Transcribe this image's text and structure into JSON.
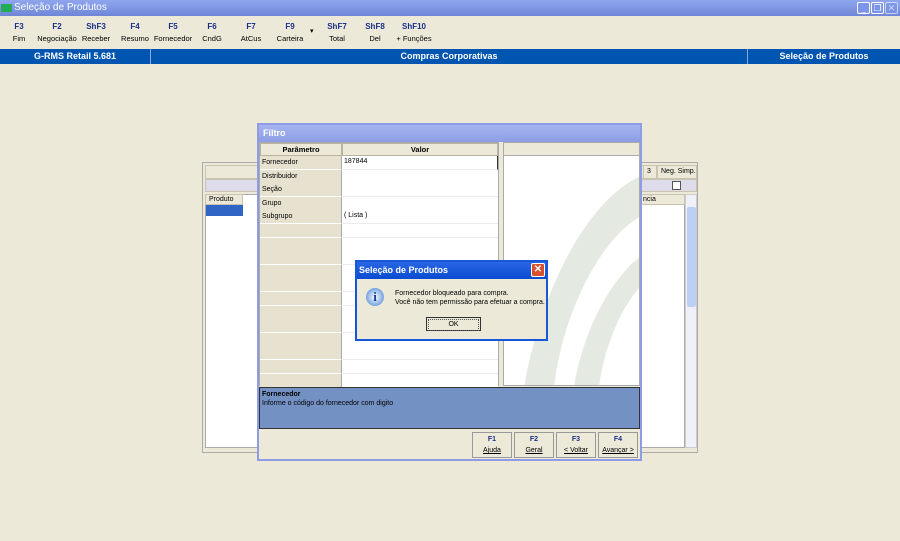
{
  "window": {
    "title": "Seleção de Produtos",
    "min": "_",
    "restore": "❐",
    "close": "✕"
  },
  "toolbar": [
    {
      "key": "F3",
      "label": "Fim"
    },
    {
      "key": "F2",
      "label": "Negociação"
    },
    {
      "key": "ShF3",
      "label": "Receber"
    },
    {
      "key": "F4",
      "label": "Resumo"
    },
    {
      "key": "F5",
      "label": "Fornecedor"
    },
    {
      "key": "F6",
      "label": "CndG"
    },
    {
      "key": "F7",
      "label": "AtCus"
    },
    {
      "key": "F9",
      "label": "Carteira"
    },
    {
      "key": "ShF7",
      "label": "Total"
    },
    {
      "key": "ShF8",
      "label": "Del"
    },
    {
      "key": "ShF10",
      "label": "+ Funções"
    }
  ],
  "toolbar_dropdown": "▾",
  "statusbar": {
    "app": "G-RMS Retail 5.681",
    "module": "Compras Corporativas",
    "screen": "Seleção de Produtos"
  },
  "background": {
    "col_produto": "Produto",
    "col_3": "3",
    "col_neg": "Neg. Simp.",
    "col_ncia": "ncia"
  },
  "filtro": {
    "title": "Filtro",
    "col_param": "Parâmetro",
    "col_valor": "Valor",
    "rows": [
      {
        "param": "Fornecedor",
        "valor": "187844"
      },
      {
        "param": "Distribuidor",
        "valor": ""
      },
      {
        "param": "Seção",
        "valor": ""
      },
      {
        "param": "Grupo",
        "valor": ""
      },
      {
        "param": "Subgrupo",
        "valor": "( Lista )"
      }
    ],
    "desc_title": "Fornecedor",
    "desc_text": "Informe o código do fornecedor com digito",
    "buttons": [
      {
        "key": "F1",
        "label": "Ajuda"
      },
      {
        "key": "F2",
        "label": "Geral"
      },
      {
        "key": "F3",
        "label": "< Voltar"
      },
      {
        "key": "F4",
        "label": "Avançar >"
      }
    ]
  },
  "message": {
    "title": "Seleção de Produtos",
    "line1": "Fornecedor bloqueado para compra.",
    "line2": "Você não tem permissão para efetuar a compra.",
    "ok": "OK",
    "close": "✕",
    "icon": "i"
  }
}
